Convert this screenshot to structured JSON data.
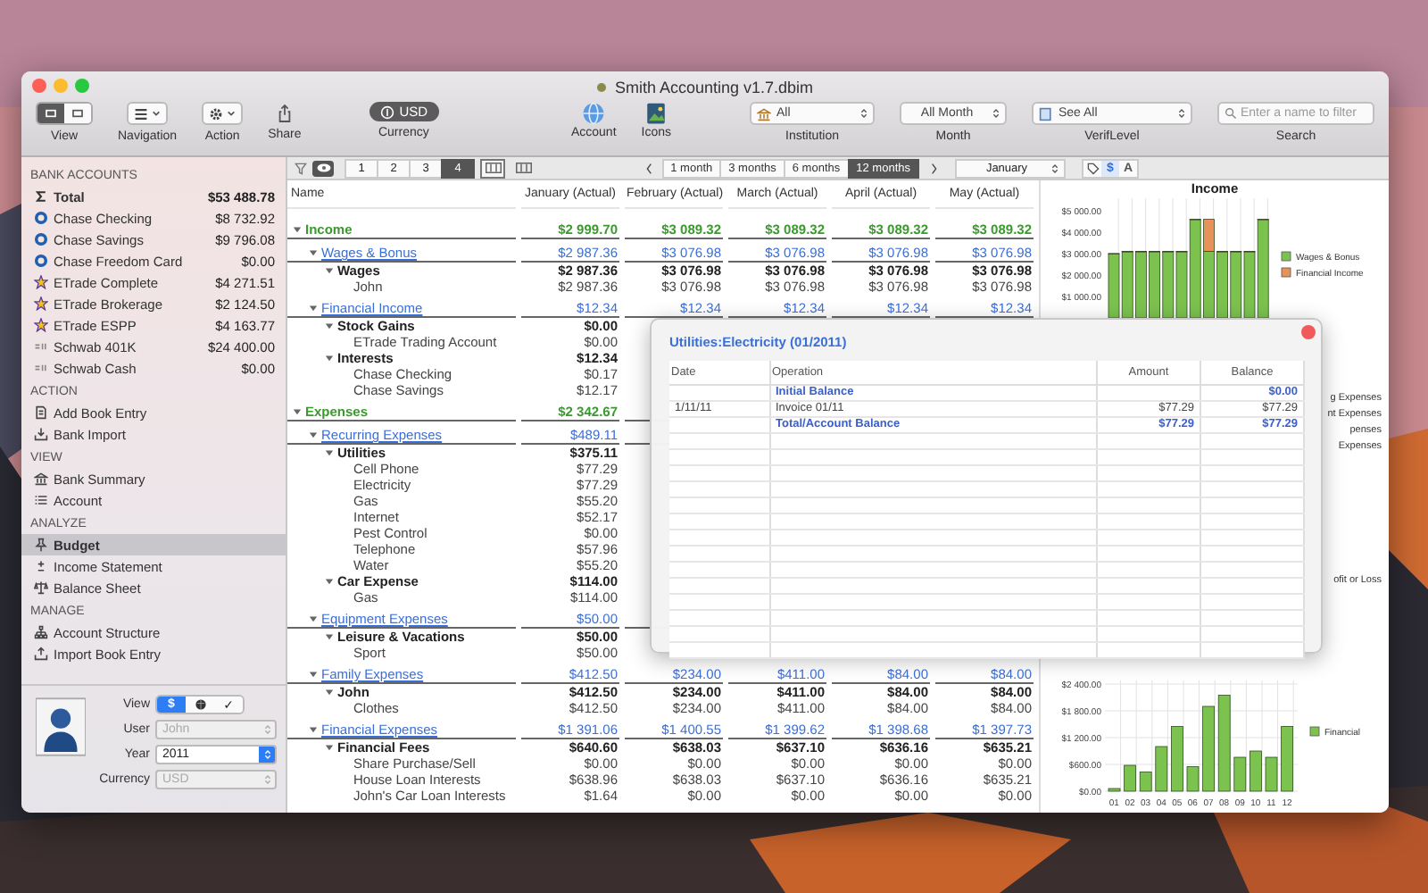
{
  "window": {
    "title": "Smith Accounting v1.7.dbim"
  },
  "toolbar": {
    "view": {
      "label": "View",
      "segments": [
        {
          "selected": true
        },
        {
          "selected": false
        }
      ]
    },
    "navigation": {
      "label": "Navigation"
    },
    "action": {
      "label": "Action"
    },
    "share": {
      "label": "Share"
    },
    "currency": {
      "label": "Currency",
      "value": "USD"
    },
    "account": {
      "label": "Account"
    },
    "icons": {
      "label": "Icons"
    },
    "institution": {
      "label": "Institution",
      "value": "All"
    },
    "month": {
      "label": "Month",
      "value": "All Month"
    },
    "verif_level": {
      "label": "VerifLevel",
      "value": "See All"
    },
    "search": {
      "label": "Search",
      "placeholder": "Enter a name to filter"
    }
  },
  "sidebar": {
    "sections": [
      {
        "title": "BANK ACCOUNTS",
        "items": [
          {
            "label": "Total",
            "amount": "$53 488.78",
            "kind": "total",
            "selected": false
          },
          {
            "label": "Chase Checking",
            "amount": "$8 732.92",
            "kind": "bank",
            "selected": false
          },
          {
            "label": "Chase Savings",
            "amount": "$9 796.08",
            "kind": "bank",
            "selected": false
          },
          {
            "label": "Chase Freedom Card",
            "amount": "$0.00",
            "kind": "bank",
            "selected": false
          },
          {
            "label": "ETrade Complete",
            "amount": "$4 271.51",
            "kind": "broker",
            "selected": false
          },
          {
            "label": "ETrade Brokerage",
            "amount": "$2 124.50",
            "kind": "broker",
            "selected": false
          },
          {
            "label": "ETrade ESPP",
            "amount": "$4 163.77",
            "kind": "broker",
            "selected": false
          },
          {
            "label": "Schwab 401K",
            "amount": "$24 400.00",
            "kind": "retirement",
            "selected": false
          },
          {
            "label": "Schwab Cash",
            "amount": "$0.00",
            "kind": "retirement",
            "selected": false
          }
        ]
      },
      {
        "title": "ACTION",
        "items": [
          {
            "label": "Add Book Entry",
            "selected": false
          },
          {
            "label": "Bank Import",
            "selected": false
          }
        ]
      },
      {
        "title": "VIEW",
        "items": [
          {
            "label": "Bank Summary",
            "selected": false
          },
          {
            "label": "Account",
            "selected": false
          }
        ]
      },
      {
        "title": "ANALYZE",
        "items": [
          {
            "label": "Budget",
            "selected": true
          },
          {
            "label": "Income Statement",
            "selected": false
          },
          {
            "label": "Balance Sheet",
            "selected": false
          }
        ]
      },
      {
        "title": "MANAGE",
        "items": [
          {
            "label": "Account Structure",
            "selected": false
          },
          {
            "label": "Import Book Entry",
            "selected": false
          }
        ]
      }
    ]
  },
  "user_panel": {
    "view": {
      "label": "View",
      "segments": [
        {
          "label": "$",
          "selected": true
        },
        {
          "selected": false
        },
        {
          "label": "✓",
          "selected": false
        }
      ]
    },
    "user": {
      "label": "User",
      "value": "John",
      "disabled": true
    },
    "year": {
      "label": "Year",
      "value": "2011",
      "disabled": false
    },
    "currency": {
      "label": "Currency",
      "value": "USD",
      "disabled": true
    }
  },
  "subbar": {
    "eye": {
      "selected": true
    },
    "levels": [
      {
        "label": "1",
        "selected": false
      },
      {
        "label": "2",
        "selected": false
      },
      {
        "label": "3",
        "selected": false
      },
      {
        "label": "4",
        "selected": true
      }
    ],
    "layouts": [
      {
        "selected": true
      },
      {
        "selected": false
      }
    ],
    "periods": [
      {
        "label": "1 month",
        "selected": false
      },
      {
        "label": "3 months",
        "selected": false
      },
      {
        "label": "6 months",
        "selected": false
      },
      {
        "label": "12 months",
        "selected": true
      }
    ],
    "month": {
      "value": "January"
    },
    "display_modes": [
      {
        "selected": false
      },
      {
        "label": "$",
        "selected": true
      },
      {
        "label": "A",
        "selected": false
      }
    ]
  },
  "table": {
    "columns": [
      "Name",
      "January (Actual)",
      "February (Actual)",
      "March (Actual)",
      "April (Actual)",
      "May (Actual)"
    ],
    "rows": [
      {
        "name": "Income",
        "kind": "section",
        "expanded": true,
        "values": [
          "$2 999.70",
          "$3 089.32",
          "$3 089.32",
          "$3 089.32",
          "$3 089.32"
        ],
        "children": [
          {
            "name": "Wages & Bonus",
            "kind": "group",
            "expanded": true,
            "values": [
              "$2 987.36",
              "$3 076.98",
              "$3 076.98",
              "$3 076.98",
              "$3 076.98"
            ],
            "children": [
              {
                "name": "Wages",
                "kind": "subgroup",
                "expanded": true,
                "values": [
                  "$2 987.36",
                  "$3 076.98",
                  "$3 076.98",
                  "$3 076.98",
                  "$3 076.98"
                ],
                "children": [
                  {
                    "name": "John",
                    "kind": "item",
                    "values": [
                      "$2 987.36",
                      "$3 076.98",
                      "$3 076.98",
                      "$3 076.98",
                      "$3 076.98"
                    ]
                  }
                ]
              }
            ]
          },
          {
            "name": "Financial Income",
            "kind": "group",
            "expanded": true,
            "values": [
              "$12.34",
              "$12.34",
              "$12.34",
              "$12.34",
              "$12.34"
            ],
            "children": [
              {
                "name": "Stock Gains",
                "kind": "subgroup",
                "expanded": true,
                "values": [
                  "$0.00"
                ],
                "children": [
                  {
                    "name": "ETrade Trading Account",
                    "kind": "item",
                    "values": [
                      "$0.00"
                    ]
                  }
                ]
              },
              {
                "name": "Interests",
                "kind": "subgroup",
                "expanded": true,
                "values": [
                  "$12.34"
                ],
                "children": [
                  {
                    "name": "Chase Checking",
                    "kind": "item",
                    "values": [
                      "$0.17"
                    ]
                  },
                  {
                    "name": "Chase Savings",
                    "kind": "item",
                    "values": [
                      "$12.17"
                    ]
                  }
                ]
              }
            ]
          }
        ]
      },
      {
        "name": "Expenses",
        "kind": "section",
        "expanded": true,
        "values": [
          "$2 342.67"
        ],
        "children": [
          {
            "name": "Recurring Expenses",
            "kind": "group",
            "expanded": true,
            "values": [
              "$489.11"
            ],
            "children": [
              {
                "name": "Utilities",
                "kind": "subgroup",
                "expanded": true,
                "values": [
                  "$375.11"
                ],
                "children": [
                  {
                    "name": "Cell Phone",
                    "kind": "item",
                    "values": [
                      "$77.29"
                    ]
                  },
                  {
                    "name": "Electricity",
                    "kind": "item",
                    "values": [
                      "$77.29"
                    ]
                  },
                  {
                    "name": "Gas",
                    "kind": "item",
                    "values": [
                      "$55.20"
                    ]
                  },
                  {
                    "name": "Internet",
                    "kind": "item",
                    "values": [
                      "$52.17"
                    ]
                  },
                  {
                    "name": "Pest Control",
                    "kind": "item",
                    "values": [
                      "$0.00"
                    ]
                  },
                  {
                    "name": "Telephone",
                    "kind": "item",
                    "values": [
                      "$57.96"
                    ]
                  },
                  {
                    "name": "Water",
                    "kind": "item",
                    "values": [
                      "$55.20"
                    ]
                  }
                ]
              },
              {
                "name": "Car Expense",
                "kind": "subgroup",
                "expanded": true,
                "values": [
                  "$114.00"
                ],
                "children": [
                  {
                    "name": "Gas",
                    "kind": "item",
                    "values": [
                      "$114.00"
                    ]
                  }
                ]
              }
            ]
          },
          {
            "name": "Equipment Expenses",
            "kind": "group",
            "expanded": true,
            "values": [
              "$50.00"
            ],
            "children": [
              {
                "name": "Leisure & Vacations",
                "kind": "subgroup",
                "expanded": true,
                "values": [
                  "$50.00"
                ],
                "children": [
                  {
                    "name": "Sport",
                    "kind": "item",
                    "values": [
                      "$50.00"
                    ]
                  }
                ]
              }
            ]
          },
          {
            "name": "Family Expenses",
            "kind": "group",
            "expanded": true,
            "values": [
              "$412.50",
              "$234.00",
              "$411.00",
              "$84.00",
              "$84.00"
            ],
            "children": [
              {
                "name": "John",
                "kind": "subgroup",
                "expanded": true,
                "values": [
                  "$412.50",
                  "$234.00",
                  "$411.00",
                  "$84.00",
                  "$84.00"
                ],
                "children": [
                  {
                    "name": "Clothes",
                    "kind": "item",
                    "values": [
                      "$412.50",
                      "$234.00",
                      "$411.00",
                      "$84.00",
                      "$84.00"
                    ]
                  }
                ]
              }
            ]
          },
          {
            "name": "Financial Expenses",
            "kind": "group",
            "expanded": true,
            "values": [
              "$1 391.06",
              "$1 400.55",
              "$1 399.62",
              "$1 398.68",
              "$1 397.73"
            ],
            "children": [
              {
                "name": "Financial Fees",
                "kind": "subgroup",
                "expanded": true,
                "values": [
                  "$640.60",
                  "$638.03",
                  "$637.10",
                  "$636.16",
                  "$635.21"
                ],
                "children": [
                  {
                    "name": "Share Purchase/Sell",
                    "kind": "item",
                    "values": [
                      "$0.00",
                      "$0.00",
                      "$0.00",
                      "$0.00",
                      "$0.00"
                    ]
                  },
                  {
                    "name": "House Loan Interests",
                    "kind": "item",
                    "values": [
                      "$638.96",
                      "$638.03",
                      "$637.10",
                      "$636.16",
                      "$635.21"
                    ]
                  },
                  {
                    "name": "John's Car Loan Interests",
                    "kind": "item",
                    "values": [
                      "$1.64",
                      "$0.00",
                      "$0.00",
                      "$0.00",
                      "$0.00"
                    ]
                  }
                ]
              }
            ]
          }
        ]
      }
    ]
  },
  "popup": {
    "title": "Utilities:Electricity (01/2011)",
    "columns": [
      "Date",
      "Operation",
      "Amount",
      "Balance"
    ],
    "rows": [
      {
        "kind": "total",
        "operation": "Initial Balance",
        "balance": "$0.00"
      },
      {
        "kind": "entry",
        "date": "1/11/11",
        "operation": "Invoice 01/11",
        "amount": "$77.29",
        "balance": "$77.29"
      },
      {
        "kind": "total",
        "operation": "Total/Account Balance",
        "amount": "$77.29",
        "balance": "$77.29"
      }
    ]
  },
  "charts": {
    "income": {
      "chart_data": {
        "type": "bar",
        "title": "Income",
        "stacked": true,
        "legend": "right",
        "grid": true,
        "ylim": [
          0,
          5000
        ],
        "yticks": [
          {
            "value": 1000,
            "label": "$1 000.00"
          },
          {
            "value": 2000,
            "label": "$2 000.00"
          },
          {
            "value": 3000,
            "label": "$3 000.00"
          },
          {
            "value": 4000,
            "label": "$4 000.00"
          },
          {
            "value": 5000,
            "label": "$5 000.00"
          }
        ],
        "series": [
          {
            "name": "Wages & Bonus",
            "color": "#7cc24f",
            "values": [
              3000,
              3100,
              3100,
              3100,
              3100,
              3100,
              4600,
              3100,
              3100,
              3100,
              3100,
              4600
            ]
          },
          {
            "name": "Financial Income",
            "color": "#e8925b",
            "values": [
              0,
              0,
              0,
              0,
              0,
              0,
              0,
              1500,
              0,
              0,
              0,
              0
            ]
          }
        ]
      }
    },
    "legend_fragments": [
      "g Expenses",
      "nt Expenses",
      "penses",
      "Expenses",
      "ofit or Loss"
    ],
    "bottom": {
      "chart_data": {
        "type": "bar",
        "legend": "right",
        "grid": true,
        "categories": [
          "01",
          "02",
          "03",
          "04",
          "05",
          "06",
          "07",
          "08",
          "09",
          "10",
          "11",
          "12"
        ],
        "ylim": [
          0,
          2400
        ],
        "yticks": [
          {
            "value": 0,
            "label": "$0.00"
          },
          {
            "value": 600,
            "label": "$600.00"
          },
          {
            "value": 1200,
            "label": "$1 200.00"
          },
          {
            "value": 1800,
            "label": "$1 800.00"
          },
          {
            "value": 2400,
            "label": "$2 400.00"
          }
        ],
        "series": [
          {
            "name": "Financial",
            "color": "#7cc24f",
            "values": [
              60,
              580,
              430,
              1000,
              1450,
              550,
              1900,
              2150,
              760,
              900,
              760,
              1450
            ]
          }
        ]
      }
    }
  }
}
